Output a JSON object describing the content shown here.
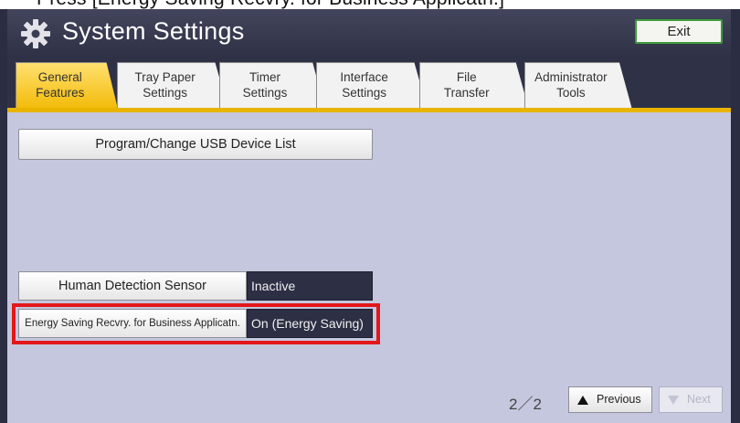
{
  "top_caption": "Press [Energy Saving Recvry. for Business Applicatn.]",
  "header": {
    "icon": "gear-icon",
    "title": "System Settings",
    "exit_label": "Exit"
  },
  "tabs": [
    {
      "label": "General\nFeatures",
      "active": true
    },
    {
      "label": "Tray Paper\nSettings",
      "active": false
    },
    {
      "label": "Timer\nSettings",
      "active": false
    },
    {
      "label": "Interface\nSettings",
      "active": false
    },
    {
      "label": "File\nTransfer",
      "active": false
    },
    {
      "label": "Administrator\nTools",
      "active": false
    }
  ],
  "main": {
    "usb_button_label": "Program/Change USB Device List",
    "settings": [
      {
        "label": "Human Detection Sensor",
        "value": "Inactive"
      },
      {
        "label": "Energy Saving Recvry. for Business Applicatn.",
        "value": "On (Energy Saving)",
        "highlighted": true
      }
    ]
  },
  "pagination": {
    "indicator": "2／2",
    "previous_label": "Previous",
    "next_label": "Next"
  },
  "colors": {
    "active_tab": "#f2b800",
    "highlight": "#e3171b",
    "exit_border": "#3c9a3c"
  }
}
